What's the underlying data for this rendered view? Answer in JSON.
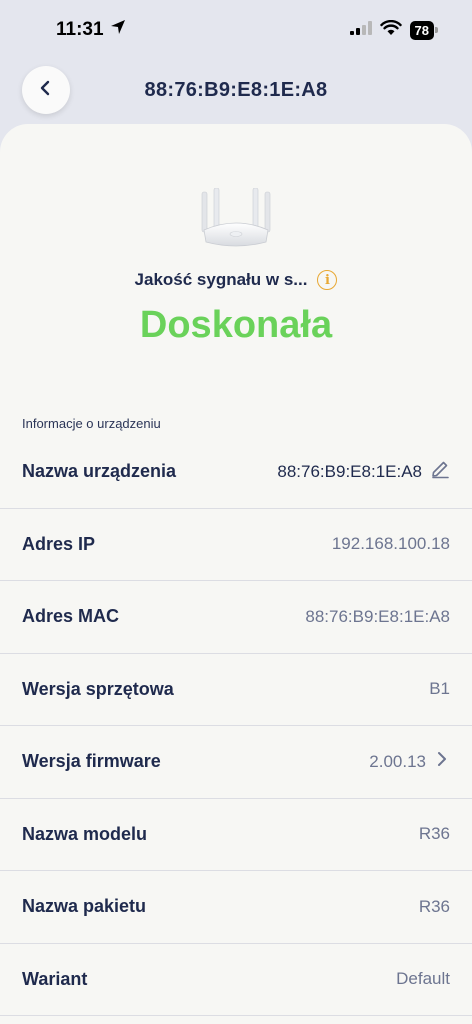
{
  "status_bar": {
    "time": "11:31",
    "battery": "78"
  },
  "header": {
    "title": "88:76:B9:E8:1E:A8"
  },
  "signal": {
    "label": "Jakość sygnału w s...",
    "quality": "Doskonała",
    "quality_color": "#6ad25a"
  },
  "device_info": {
    "section_title": "Informacje o urządzeniu",
    "rows": [
      {
        "label": "Nazwa urządzenia",
        "value": "88:76:B9:E8:1E:A8",
        "action": "edit"
      },
      {
        "label": "Adres IP",
        "value": "192.168.100.18"
      },
      {
        "label": "Adres MAC",
        "value": "88:76:B9:E8:1E:A8"
      },
      {
        "label": "Wersja sprzętowa",
        "value": "B1"
      },
      {
        "label": "Wersja firmware",
        "value": "2.00.13",
        "action": "chevron"
      },
      {
        "label": "Nazwa modelu",
        "value": "R36"
      },
      {
        "label": "Nazwa pakietu",
        "value": "R36"
      },
      {
        "label": "Wariant",
        "value": "Default"
      }
    ]
  }
}
